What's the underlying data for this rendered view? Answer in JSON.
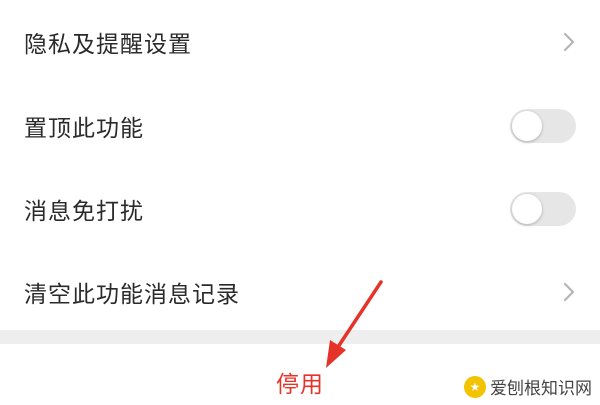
{
  "settings": {
    "items": [
      {
        "label": "隐私及提醒设置",
        "control": "chevron"
      },
      {
        "label": "置顶此功能",
        "control": "toggle",
        "enabled": false
      },
      {
        "label": "消息免打扰",
        "control": "toggle",
        "enabled": false
      },
      {
        "label": "清空此功能消息记录",
        "control": "chevron"
      }
    ]
  },
  "footer": {
    "stop_label": "停用"
  },
  "annotation": {
    "arrow_color": "#e5332a"
  },
  "watermark": {
    "text": "爱刨根知识网"
  },
  "colors": {
    "accent": "#e5332a",
    "toggle_off": "#e6e6e6",
    "divider": "#eeeeee"
  }
}
